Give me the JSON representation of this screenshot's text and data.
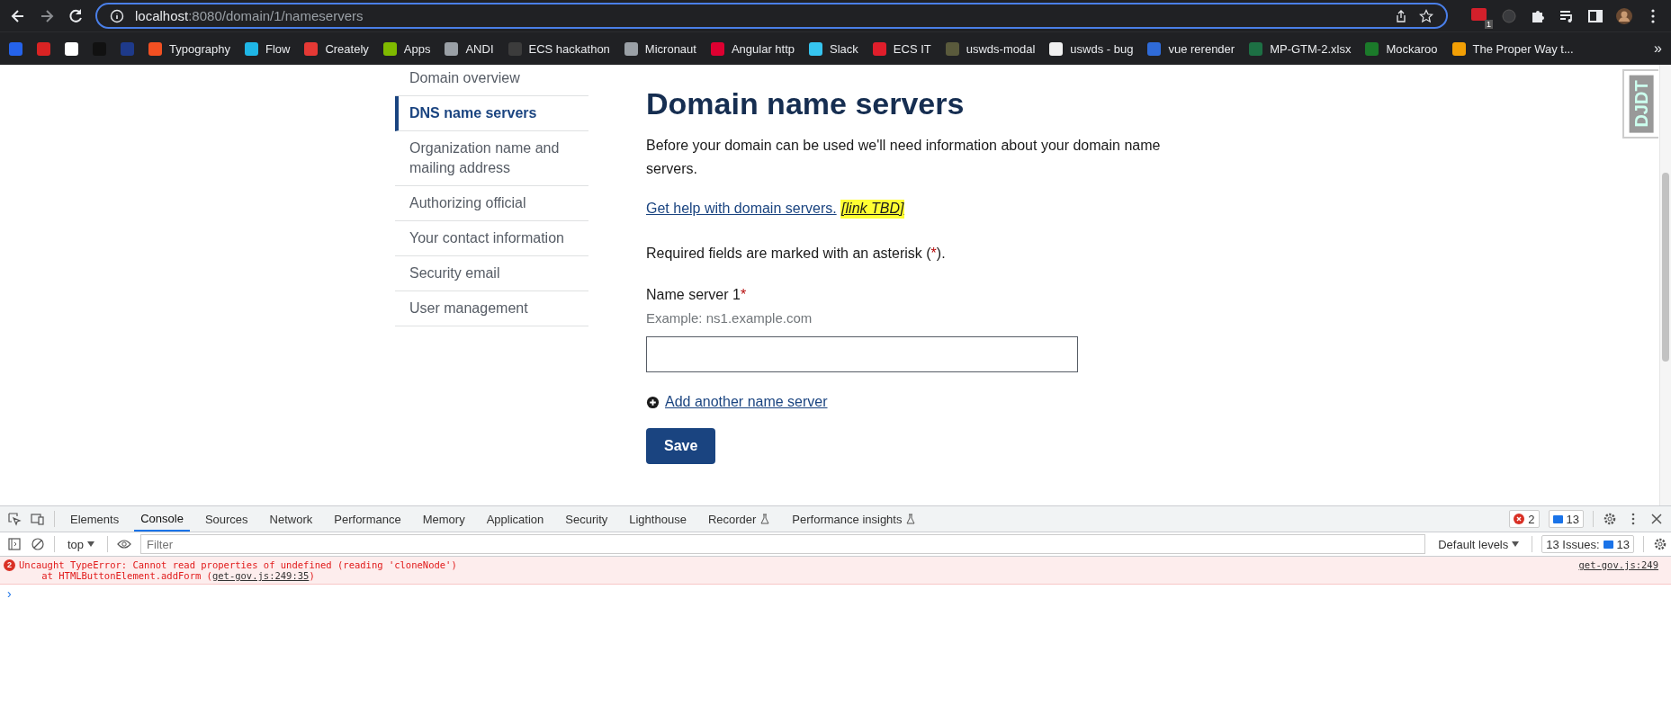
{
  "browser": {
    "url_host": "localhost",
    "url_rest": ":8080/domain/1/nameservers",
    "extension_badge": "1"
  },
  "bookmarks": [
    {
      "color": "#2563eb"
    },
    {
      "color": "#d92323"
    },
    {
      "color": "#ffffff"
    },
    {
      "color": "#111111"
    },
    {
      "color": "#1e3a8a"
    },
    {
      "label": "Typography",
      "color": "#f25022"
    },
    {
      "label": "Flow",
      "color": "#1fb6e6"
    },
    {
      "label": "Creately",
      "color": "#e53935"
    },
    {
      "label": "Apps",
      "color": "#7fba00"
    },
    {
      "label": "ANDI",
      "color": "#9aa0a6"
    },
    {
      "label": "ECS hackathon",
      "color": "#3c3c3c"
    },
    {
      "label": "Micronaut",
      "color": "#9aa0a6"
    },
    {
      "label": "Angular http",
      "color": "#dd0031"
    },
    {
      "label": "Slack",
      "color": "#36c5f0"
    },
    {
      "label": "ECS IT",
      "color": "#e01e2b"
    },
    {
      "label": "uswds-modal",
      "color": "#5a5a3c"
    },
    {
      "label": "uswds - bug",
      "color": "#f0f0f0"
    },
    {
      "label": "vue rerender",
      "color": "#2f6bd8"
    },
    {
      "label": "MP-GTM-2.xlsx",
      "color": "#1d7044"
    },
    {
      "label": "Mockaroo",
      "color": "#1b7a2a"
    },
    {
      "label": "The Proper Way t...",
      "color": "#f29f05"
    }
  ],
  "bookmarks_more": "»",
  "sidebar": {
    "items": [
      {
        "label": "Domain overview",
        "selected": false
      },
      {
        "label": "DNS name servers",
        "selected": true
      },
      {
        "label": "Organization name and mailing address",
        "selected": false
      },
      {
        "label": "Authorizing official",
        "selected": false
      },
      {
        "label": "Your contact information",
        "selected": false
      },
      {
        "label": "Security email",
        "selected": false
      },
      {
        "label": "User management",
        "selected": false
      }
    ]
  },
  "main": {
    "title": "Domain name servers",
    "intro": "Before your domain can be used we'll need information about your domain name servers.",
    "help_link": "Get help with domain servers.",
    "help_tbd": "[link TBD]",
    "required_before": "Required fields are marked with an asterisk (",
    "required_mark": "*",
    "required_after": ").",
    "fields": [
      {
        "label": "Name server 1",
        "required": true,
        "hint": "Example: ns1.example.com"
      }
    ],
    "add_link": "Add another name server",
    "save": "Save"
  },
  "debug_toolbar": {
    "label": "DJDT"
  },
  "devtools": {
    "tabs": [
      {
        "label": "Elements",
        "selected": false,
        "experimental": false
      },
      {
        "label": "Console",
        "selected": true,
        "experimental": false
      },
      {
        "label": "Sources",
        "selected": false,
        "experimental": false
      },
      {
        "label": "Network",
        "selected": false,
        "experimental": false
      },
      {
        "label": "Performance",
        "selected": false,
        "experimental": false
      },
      {
        "label": "Memory",
        "selected": false,
        "experimental": false
      },
      {
        "label": "Application",
        "selected": false,
        "experimental": false
      },
      {
        "label": "Security",
        "selected": false,
        "experimental": false
      },
      {
        "label": "Lighthouse",
        "selected": false,
        "experimental": false
      },
      {
        "label": "Recorder",
        "selected": false,
        "experimental": true
      },
      {
        "label": "Performance insights",
        "selected": false,
        "experimental": true
      }
    ],
    "error_count": "2",
    "message_count": "13",
    "context": "top",
    "filter_placeholder": "Filter",
    "levels": "Default levels",
    "issues_label": "13 Issues:",
    "issues_count": "13",
    "messages": [
      {
        "count": "2",
        "text": "Uncaught TypeError: Cannot read properties of undefined (reading 'cloneNode')",
        "trace_before": "    at HTMLButtonElement.addForm (",
        "trace_link": "get-gov.js:249:35",
        "trace_after": ")",
        "source": "get-gov.js:249"
      }
    ],
    "prompt": "›"
  }
}
